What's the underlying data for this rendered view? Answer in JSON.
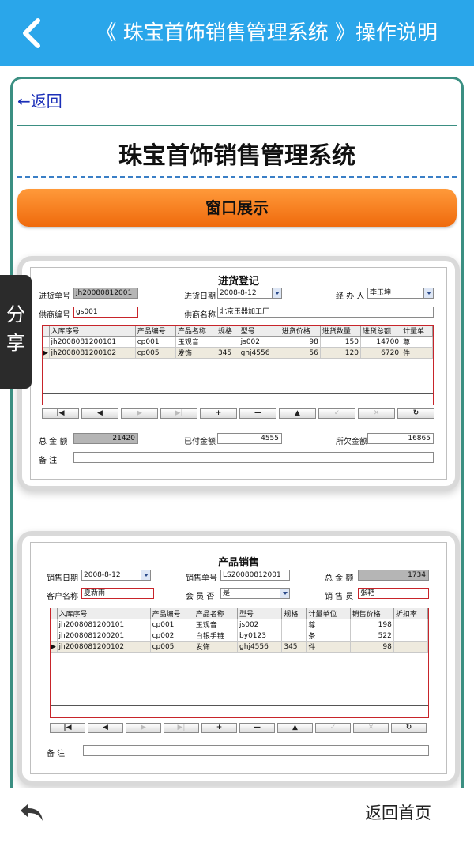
{
  "header": {
    "title": "《 珠宝首饰销售管理系统 》操作说明"
  },
  "share": {
    "line1": "分",
    "line2": "享"
  },
  "content": {
    "return_link": "←返回",
    "system_title": "珠宝首饰销售管理系统",
    "section_button": "窗口展示"
  },
  "purchase": {
    "title": "进货登记",
    "order_no_label": "进货单号",
    "order_no": "jh20080812001",
    "date_label": "进货日期",
    "date": "2008-8-12",
    "handler_label": "经 办 人",
    "handler": "李玉坤",
    "supplier_no_label": "供商编号",
    "supplier_no": "gs001",
    "supplier_name_label": "供商名称",
    "supplier_name": "北京玉器加工厂",
    "columns": [
      "入库序号",
      "产品编号",
      "产品名称",
      "规格",
      "型号",
      "进货价格",
      "进货数量",
      "进货总额",
      "计量单"
    ],
    "rows": [
      [
        "jh2008081200101",
        "cp001",
        "玉观音",
        "",
        "js002",
        "98",
        "150",
        "14700",
        "尊"
      ],
      [
        "jh2008081200102",
        "cp005",
        "发饰",
        "345",
        "ghj4556",
        "56",
        "120",
        "6720",
        "件"
      ]
    ],
    "total_label": "总 金 额",
    "total": "21420",
    "paid_label": "已付金额",
    "paid": "4555",
    "owed_label": "所欠金额",
    "owed": "16865",
    "remark_label": "备    注"
  },
  "sales": {
    "title": "产品销售",
    "date_label": "销售日期",
    "date": "2008-8-12",
    "order_no_label": "销售单号",
    "order_no": "LS20080812001",
    "total_label": "总 金 额",
    "total": "1734",
    "customer_label": "客户名称",
    "customer": "夏新雨",
    "member_label": "会 员 否",
    "member": "是",
    "seller_label": "销 售 员",
    "seller": "张艳",
    "columns": [
      "入库序号",
      "产品编号",
      "产品名称",
      "型号",
      "规格",
      "计量单位",
      "销售价格",
      "折扣率"
    ],
    "rows": [
      [
        "jh2008081200101",
        "cp001",
        "玉观音",
        "js002",
        "",
        "尊",
        "198",
        ""
      ],
      [
        "jh2008081200201",
        "cp002",
        "白银手链",
        "by0123",
        "",
        "条",
        "522",
        ""
      ],
      [
        "jh2008081200102",
        "cp005",
        "发饰",
        "ghj4556",
        "345",
        "件",
        "98",
        ""
      ]
    ],
    "remark_label": "备    注"
  },
  "nav_buttons": [
    "|◀",
    "◀",
    "▶",
    "▶|",
    "+",
    "—",
    "▲",
    "✓",
    "✕",
    "↻"
  ],
  "bottom": {
    "home_label": "返回首页"
  },
  "colors": {
    "header": "#2aa6ea",
    "button_orange": "#ef6a0c",
    "frame": "#3b8f82",
    "link": "#1b2fb8"
  }
}
